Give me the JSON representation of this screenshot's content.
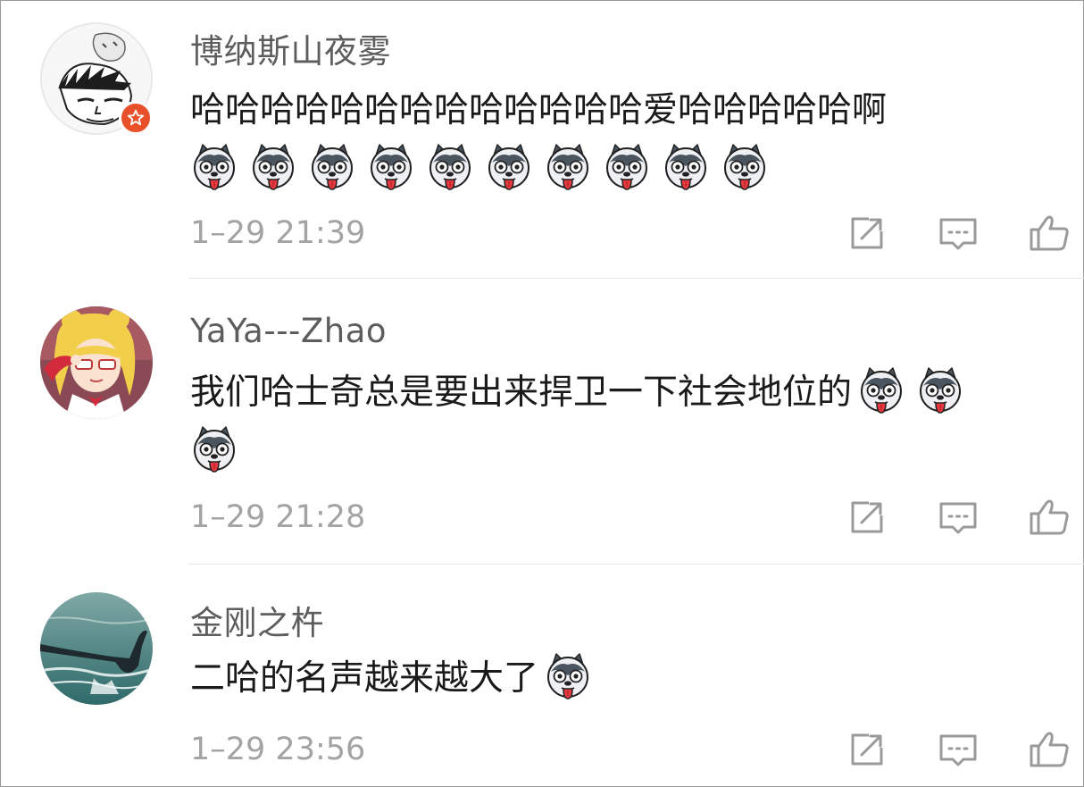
{
  "comments": [
    {
      "username": "博纳斯山夜雾",
      "text": "哈哈哈哈哈哈哈哈哈哈哈哈哈爱哈哈哈哈哈啊",
      "emoji_count": 10,
      "emoji_name": "husky-emoji",
      "timestamp": "1–29 21:39",
      "has_vip_badge": true
    },
    {
      "username": "YaYa---Zhao",
      "text": "我们哈士奇总是要出来捍卫一下社会地位的",
      "emoji_count": 3,
      "emoji_name": "husky-emoji",
      "timestamp": "1–29 21:28",
      "has_vip_badge": false
    },
    {
      "username": "金刚之杵",
      "text": "二哈的名声越来越大了",
      "emoji_count": 1,
      "emoji_name": "husky-emoji",
      "timestamp": "1–29 23:56",
      "has_vip_badge": false
    }
  ],
  "actions": {
    "share": "share-icon",
    "reply": "comment-icon",
    "like": "thumbs-up-icon"
  },
  "colors": {
    "badge": "#e8502a",
    "icon": "#9a9a9a",
    "timestamp": "#a3a3a3",
    "username": "#5d5d5d"
  }
}
